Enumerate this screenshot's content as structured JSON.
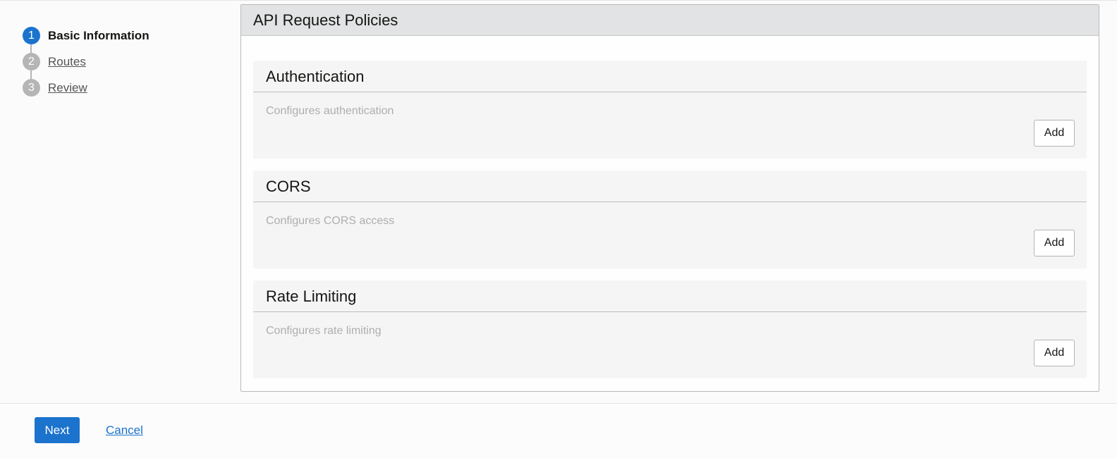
{
  "steps": [
    {
      "number": "1",
      "label": "Basic Information",
      "active": true
    },
    {
      "number": "2",
      "label": "Routes",
      "active": false
    },
    {
      "number": "3",
      "label": "Review",
      "active": false
    }
  ],
  "panel": {
    "title": "API Request Policies",
    "policies": [
      {
        "title": "Authentication",
        "description": "Configures authentication",
        "button_label": "Add"
      },
      {
        "title": "CORS",
        "description": "Configures CORS access",
        "button_label": "Add"
      },
      {
        "title": "Rate Limiting",
        "description": "Configures rate limiting",
        "button_label": "Add"
      }
    ]
  },
  "footer": {
    "next_label": "Next",
    "cancel_label": "Cancel"
  },
  "colors": {
    "accent": "#1b73cd",
    "step_inactive": "#b5b5b5",
    "panel_header_bg": "#e1e3e5",
    "section_bg": "#f5f5f5"
  }
}
